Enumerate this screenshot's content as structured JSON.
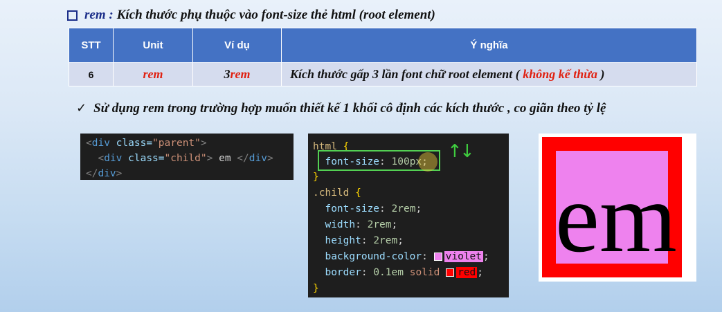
{
  "heading": {
    "keyword": "rem :",
    "text": "Kích thước phụ thuộc vào font-size thẻ html (root element)"
  },
  "table": {
    "headers": [
      "STT",
      "Unit",
      "Ví dụ",
      "Ý nghĩa"
    ],
    "rows": [
      {
        "stt": "6",
        "unit": "rem",
        "example_num": "3",
        "example_unit": "rem",
        "meaning": "Kích thước gấp 3 lần font chữ root element (",
        "meaning_red": " không kế thừa",
        "meaning_end": " )"
      }
    ]
  },
  "bullet": {
    "icon": "check-icon",
    "text": "Sử dụng rem trong trường hợp muốn thiết kế 1 khối cô định các kích thước , co giãn theo tỷ lệ"
  },
  "html_code": {
    "line1": {
      "open": "<",
      "tag": "div",
      "attr": " class=",
      "value": "\"parent\"",
      "close": ">"
    },
    "line2": {
      "open": "<",
      "tag": "div",
      "attr": " class=",
      "value": "\"child\"",
      "close": ">",
      "text": " em ",
      "end_open": "</",
      "end_tag": "div",
      "end_close": ">"
    },
    "line3": {
      "open": "</",
      "tag": "div",
      "close": ">"
    }
  },
  "css_code": {
    "html_selector": "html",
    "open_brace": " {",
    "close_brace": "}",
    "font_size_prop": "font-size",
    "font_size_value": "100px",
    "child_selector": ".child",
    "child_font_size_prop": "font-size",
    "child_font_size_value": "2rem",
    "width_prop": "width",
    "width_value": "2rem",
    "height_prop": "height",
    "height_value": "2rem",
    "bg_prop": "background-color",
    "bg_value": "violet",
    "border_prop": "border",
    "border_num": "0.1em",
    "border_style": " solid ",
    "border_color": "red",
    "colon": ": ",
    "semicolon": ";"
  },
  "arrows": {
    "up": "↑",
    "down": "↓"
  },
  "preview": {
    "text": "em"
  },
  "colors": {
    "header_bg": "#4472c4",
    "row_bg": "#d5dcee",
    "accent_red": "#e02010",
    "violet": "#ee82ee",
    "red": "#ff0000"
  }
}
